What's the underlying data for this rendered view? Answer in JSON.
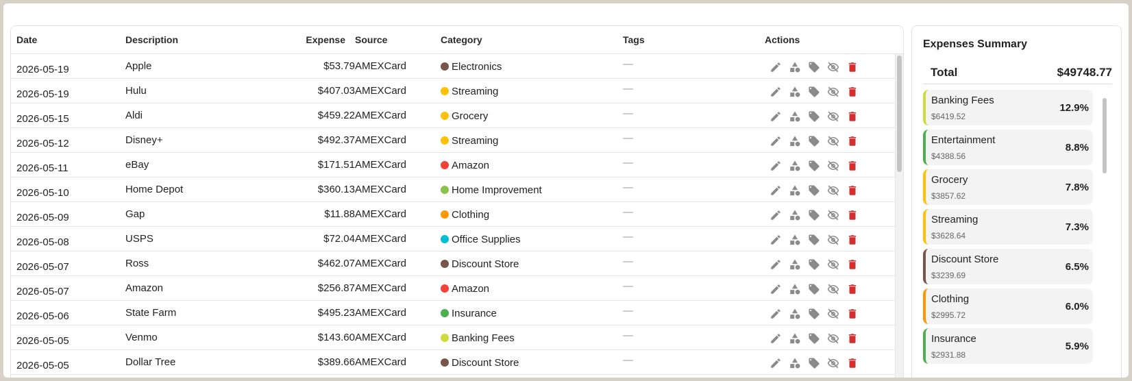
{
  "table": {
    "headers": {
      "date": "Date",
      "description": "Description",
      "expense": "Expense",
      "source": "Source",
      "category": "Category",
      "tags": "Tags",
      "actions": "Actions"
    },
    "empty_tag": "—",
    "rows": [
      {
        "date": "2026-05-19",
        "description": "Apple",
        "expense": "$53.79",
        "source": "AMEXCard",
        "category": "Electronics",
        "category_color": "#795548"
      },
      {
        "date": "2026-05-19",
        "description": "Hulu",
        "expense": "$407.03",
        "source": "AMEXCard",
        "category": "Streaming",
        "category_color": "#FFC107"
      },
      {
        "date": "2026-05-15",
        "description": "Aldi",
        "expense": "$459.22",
        "source": "AMEXCard",
        "category": "Grocery",
        "category_color": "#FFC107"
      },
      {
        "date": "2026-05-12",
        "description": "Disney+",
        "expense": "$492.37",
        "source": "AMEXCard",
        "category": "Streaming",
        "category_color": "#FFC107"
      },
      {
        "date": "2026-05-11",
        "description": "eBay",
        "expense": "$171.51",
        "source": "AMEXCard",
        "category": "Amazon",
        "category_color": "#F44336"
      },
      {
        "date": "2026-05-10",
        "description": "Home Depot",
        "expense": "$360.13",
        "source": "AMEXCard",
        "category": "Home Improvement",
        "category_color": "#8BC34A"
      },
      {
        "date": "2026-05-09",
        "description": "Gap",
        "expense": "$11.88",
        "source": "AMEXCard",
        "category": "Clothing",
        "category_color": "#FF9800"
      },
      {
        "date": "2026-05-08",
        "description": "USPS",
        "expense": "$72.04",
        "source": "AMEXCard",
        "category": "Office Supplies",
        "category_color": "#00BCD4"
      },
      {
        "date": "2026-05-07",
        "description": "Ross",
        "expense": "$462.07",
        "source": "AMEXCard",
        "category": "Discount Store",
        "category_color": "#795548"
      },
      {
        "date": "2026-05-07",
        "description": "Amazon",
        "expense": "$256.87",
        "source": "AMEXCard",
        "category": "Amazon",
        "category_color": "#F44336"
      },
      {
        "date": "2026-05-06",
        "description": "State Farm",
        "expense": "$495.23",
        "source": "AMEXCard",
        "category": "Insurance",
        "category_color": "#4CAF50"
      },
      {
        "date": "2026-05-05",
        "description": "Venmo",
        "expense": "$143.60",
        "source": "AMEXCard",
        "category": "Banking Fees",
        "category_color": "#CDDC39"
      },
      {
        "date": "2026-05-05",
        "description": "Dollar Tree",
        "expense": "$389.66",
        "source": "AMEXCard",
        "category": "Discount Store",
        "category_color": "#795548"
      }
    ],
    "action_icons": [
      "edit-icon",
      "shapes-icon",
      "tag-icon",
      "visibility-off-icon",
      "delete-icon"
    ]
  },
  "summary": {
    "title": "Expenses Summary",
    "total_label": "Total",
    "total_value": "$49748.77",
    "categories": [
      {
        "name": "Banking Fees",
        "amount": "$6419.52",
        "percent": "12.9%",
        "color": "#CDDC39"
      },
      {
        "name": "Entertainment",
        "amount": "$4388.56",
        "percent": "8.8%",
        "color": "#4CAF50"
      },
      {
        "name": "Grocery",
        "amount": "$3857.62",
        "percent": "7.8%",
        "color": "#FFC107"
      },
      {
        "name": "Streaming",
        "amount": "$3628.64",
        "percent": "7.3%",
        "color": "#FFC107"
      },
      {
        "name": "Discount Store",
        "amount": "$3239.69",
        "percent": "6.5%",
        "color": "#795548"
      },
      {
        "name": "Clothing",
        "amount": "$2995.72",
        "percent": "6.0%",
        "color": "#FF9800"
      },
      {
        "name": "Insurance",
        "amount": "$2931.88",
        "percent": "5.9%",
        "color": "#4CAF50"
      }
    ]
  },
  "colors": {
    "icon_gray": "#8a8a8a",
    "delete_red": "#d32f2f"
  }
}
